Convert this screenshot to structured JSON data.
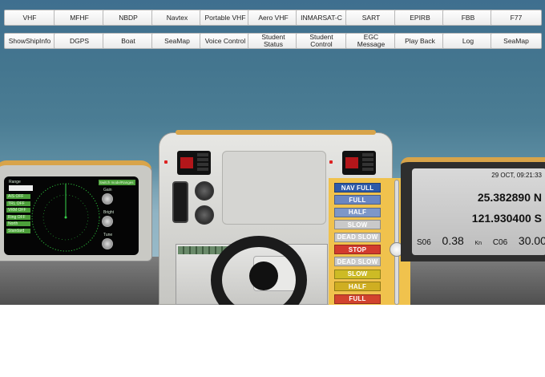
{
  "toolbar_row1": [
    "VHF",
    "MFHF",
    "NBDP",
    "Navtex",
    "Portable VHF",
    "Aero VHF",
    "INMARSAT-C",
    "SART",
    "EPIRB",
    "FBB",
    "F77"
  ],
  "toolbar_row2": [
    "ShowShipInfo",
    "DGPS",
    "Boat",
    "SeaMap",
    "Voice Control",
    "Student\nStatus",
    "Student\nControl",
    "EGC\nMessage",
    "Play Back",
    "Log",
    "SeaMap"
  ],
  "telegraph": [
    {
      "label": "NAV FULL",
      "color": "#2e5aa8"
    },
    {
      "label": "FULL",
      "color": "#6a86c2"
    },
    {
      "label": "HALF",
      "color": "#7d97c8"
    },
    {
      "label": "SLOW",
      "color": "#c9c9c9"
    },
    {
      "label": "DEAD SLOW",
      "color": "#c9c9c9"
    },
    {
      "label": "STOP",
      "color": "#d23a2e"
    },
    {
      "label": "DEAD SLOW",
      "color": "#c9c9c9"
    },
    {
      "label": "SLOW",
      "color": "#cdbb25"
    },
    {
      "label": "HALF",
      "color": "#cfae22"
    },
    {
      "label": "FULL",
      "color": "#d2432e"
    }
  ],
  "gps": {
    "date": "29 OCT,  09:21:33",
    "lat": "25.382890 N",
    "lon": "121.930400 S",
    "sog_label": "S06",
    "sog_value": "0.38",
    "sog_unit": "Kn",
    "cog_label": "C06",
    "cog_value": "30.00"
  },
  "radar": {
    "range_label": "Range",
    "top_button": "Switch mode/Ranges",
    "buttons": [
      "AIS OFF",
      "TRL OFF",
      "VRM OFF",
      "Ring OFF",
      "North",
      "Standard"
    ],
    "knobs": [
      "Gain",
      "Bright",
      "Tune"
    ]
  }
}
